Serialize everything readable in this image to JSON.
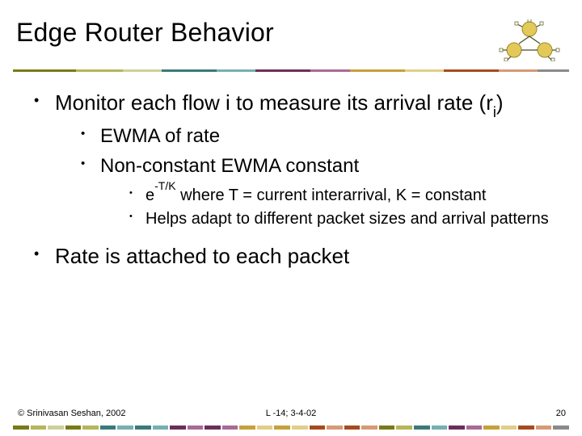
{
  "title": "Edge Router Behavior",
  "bullets": {
    "p1_pre": "Monitor each flow i to measure its arrival rate (r",
    "p1_sub": "i",
    "p1_post": ")",
    "p1a": "EWMA of rate",
    "p1b": "Non-constant EWMA constant",
    "p1b_i_pre": "e",
    "p1b_i_sup": "-T/K",
    "p1b_i_post": " where T = current interarrival, K = constant",
    "p1b_ii": "Helps adapt to different packet sizes and arrival patterns",
    "p2": "Rate is attached to each packet"
  },
  "footer": {
    "copyright": "© Srinivasan Seshan, 2002",
    "center": "L -14; 3-4-02",
    "page": "20"
  },
  "palette": {
    "olive": "#7a7a18",
    "khaki": "#b5b55a",
    "ltoliv": "#cfcf9a",
    "teal": "#3a7a7a",
    "lteal": "#76b0b0",
    "plum": "#6b2f5a",
    "lplum": "#a86a96",
    "gold": "#c6a13a",
    "lgold": "#e0cf8a",
    "rust": "#a64b1e",
    "lrust": "#d69a76",
    "gray": "#8a8a8a"
  }
}
